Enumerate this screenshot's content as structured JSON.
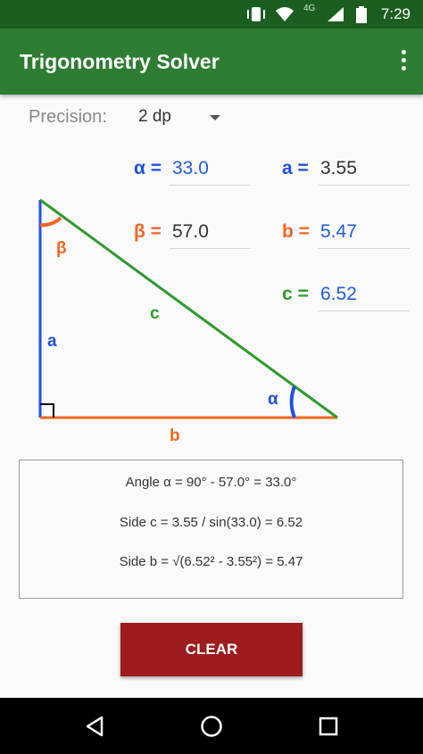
{
  "status_bar": {
    "time": "7:29",
    "network": "4G"
  },
  "app_bar": {
    "title": "Trigonometry Solver"
  },
  "precision": {
    "label": "Precision:",
    "value": "2 dp"
  },
  "fields": {
    "alpha": {
      "label": "α =",
      "value": "33.0"
    },
    "beta": {
      "label": "β =",
      "value": "57.0"
    },
    "a": {
      "label": "a =",
      "value": "3.55"
    },
    "b": {
      "label": "b =",
      "value": "5.47"
    },
    "c": {
      "label": "c =",
      "value": "6.52"
    }
  },
  "diagram": {
    "side_a": "a",
    "side_b": "b",
    "side_c": "c",
    "angle_alpha": "α",
    "angle_beta": "β"
  },
  "solution": {
    "line1": "Angle α = 90° - 57.0° = 33.0°",
    "line2": "Side c = 3.55 / sin(33.0) = 6.52",
    "line3": "Side b = √(6.52² - 3.55²) = 5.47"
  },
  "clear_button": {
    "label": "CLEAR"
  },
  "colors": {
    "status_bar": "#1b5e20",
    "app_bar": "#2e7d32",
    "side_a": "#1e4fe6",
    "side_b": "#f26522",
    "side_c": "#2e9a2e",
    "clear_button": "#9e1b1e"
  }
}
